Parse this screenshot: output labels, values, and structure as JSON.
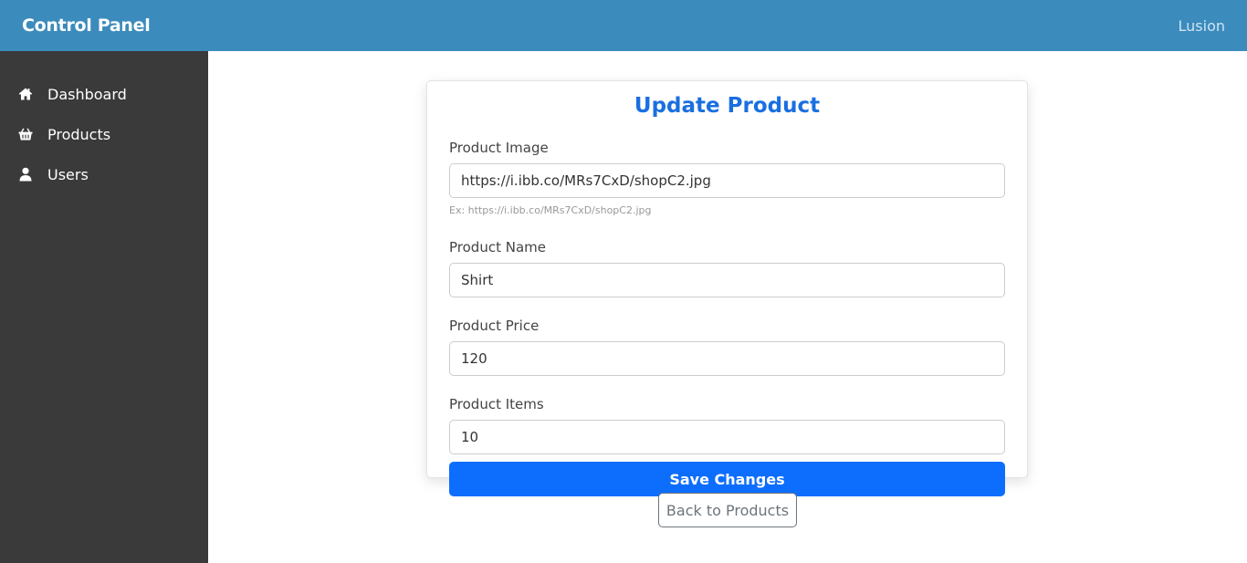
{
  "header": {
    "brand": "Control Panel",
    "user": "Lusion"
  },
  "sidebar": {
    "items": [
      {
        "label": "Dashboard",
        "icon": "home-icon"
      },
      {
        "label": "Products",
        "icon": "basket-icon"
      },
      {
        "label": "Users",
        "icon": "user-icon"
      }
    ]
  },
  "form": {
    "title": "Update Product",
    "image": {
      "label": "Product Image",
      "value": "https://i.ibb.co/MRs7CxD/shopC2.jpg",
      "help": "Ex: https://i.ibb.co/MRs7CxD/shopC2.jpg"
    },
    "name": {
      "label": "Product Name",
      "value": "Shirt"
    },
    "price": {
      "label": "Product Price",
      "value": "120"
    },
    "items": {
      "label": "Product Items",
      "value": "10"
    },
    "save_label": "Save Changes"
  },
  "back_label": "Back to Products",
  "colors": {
    "header_bg": "#3b8bbd",
    "sidebar_bg": "#3a3a3a",
    "title": "#1a6fe0",
    "primary_button": "#0d6efd"
  }
}
